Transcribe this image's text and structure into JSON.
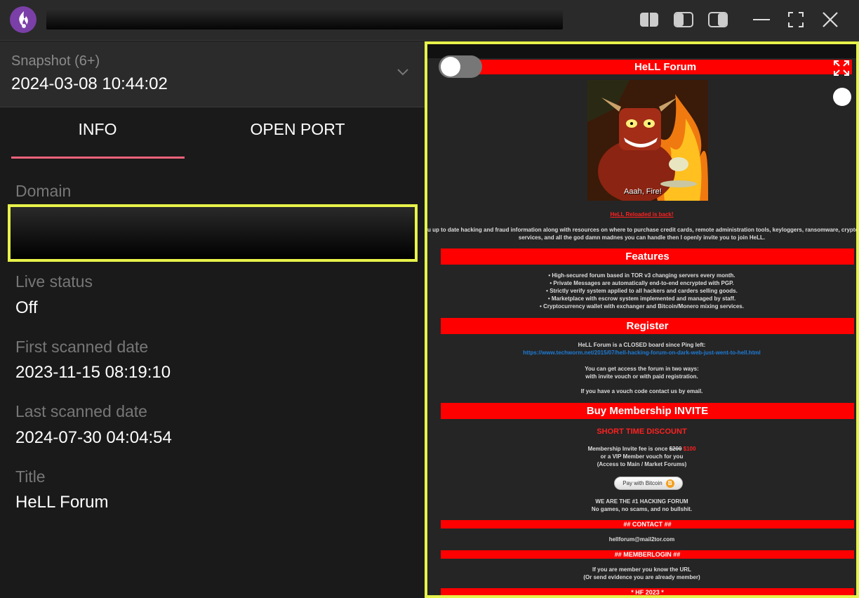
{
  "app": {
    "accent_color": "#f0627a",
    "highlight_color": "#e7f24a",
    "logo_icon": "flame-logo-icon"
  },
  "snapshot": {
    "label": "Snapshot (6+)",
    "value": "2024-03-08 10:44:02"
  },
  "tabs": [
    {
      "label": "INFO",
      "active": true
    },
    {
      "label": "OPEN PORT",
      "active": false
    }
  ],
  "info": {
    "domain_label": "Domain",
    "live_status_label": "Live status",
    "live_status_value": "Off",
    "first_scanned_label": "First scanned date",
    "first_scanned_value": "2023-11-15 08:19:10",
    "last_scanned_label": "Last scanned date",
    "last_scanned_value": "2024-07-30 04:04:54",
    "title_label": "Title",
    "title_value": "HeLL Forum"
  },
  "preview": {
    "header": "HeLL Forum",
    "image_caption": "Aaah, Fire!",
    "reloaded": "HeLL Reloaded is back!",
    "intro_line1": "u up to date hacking and fraud information along with resources on where to purchase credit cards, remote administration tools, keyloggers, ransomware, crypte",
    "intro_line2": "services, and all the god damn madnes you can handle then I openly invite you to join HeLL.",
    "features_title": "Features",
    "features": [
      "High-secured forum based in TOR v3 changing servers every month.",
      "Private Messages are automatically end-to-end encrypted with PGP.",
      "Strictly verify system applied to all hackers and carders selling goods.",
      "Marketplace with escrow system implemented and managed by staff.",
      "Cryptocurrency wallet with exchanger and Bitcoin/Monero mixing services."
    ],
    "register_title": "Register",
    "register_line1": "HeLL Forum is a CLOSED board since Ping left:",
    "register_link": "https://www.techworm.net/2015/07/hell-hacking-forum-on-dark-web-just-went-to-hell.html",
    "register_line2": "You can get access the forum in two ways:",
    "register_line3": "with invite vouch or with paid registration.",
    "register_line4": "If you have a vouch code contact us by email.",
    "membership_title": "Buy Membership INVITE",
    "discount": "SHORT TIME DISCOUNT",
    "fee_prefix": "Membership Invite fee is once ",
    "fee_old": "$200",
    "fee_new": "$100",
    "fee_line2": "or a VIP Member vouch for you",
    "fee_line3": "(Access to Main / Market Forums)",
    "pay_button": "Pay with Bitcoin",
    "pay_icon": "B",
    "number_one_line1": "WE ARE THE #1 HACKING FORUM",
    "number_one_line2": "No games, no scams, and no bullshit.",
    "contact_title": "## CONTACT ##",
    "contact_email": "hellforum@mail2tor.com",
    "memberlogin_title": "## MEMBERLOGIN ##",
    "memberlogin_line1": "If you are member you know the URL",
    "memberlogin_line2": "(Or send evidence you are already member)",
    "footer_title": "* HF 2023 *"
  }
}
